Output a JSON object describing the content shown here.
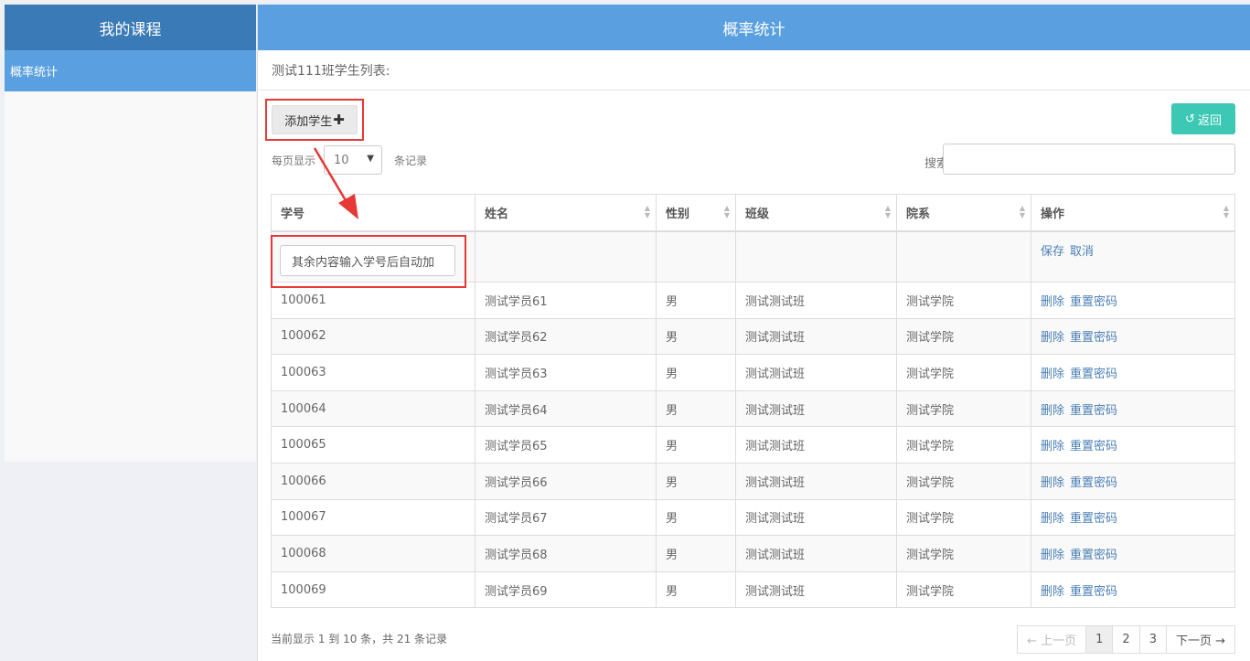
{
  "sidebar": {
    "title": "我的课程",
    "items": [
      {
        "label": "概率统计"
      }
    ]
  },
  "main": {
    "title": "概率统计",
    "subtitle": "测试111班学生列表:",
    "add_student_label": "添加学生",
    "back_label": "返回",
    "per_page_prefix": "每页显示",
    "per_page_value": "10",
    "per_page_suffix": "条记录",
    "search_label": "搜索",
    "search_value": ""
  },
  "table": {
    "columns": [
      "学号",
      "姓名",
      "性别",
      "班级",
      "院系",
      "操作"
    ],
    "edit_row": {
      "input_placeholder": "其余内容输入学号后自动加",
      "save_label": "保存",
      "cancel_label": "取消"
    },
    "action_labels": {
      "delete": "删除",
      "reset": "重置密码"
    },
    "rows": [
      {
        "id": "100061",
        "name": "测试学员61",
        "gender": "男",
        "class": "测试测试班",
        "dept": "测试学院"
      },
      {
        "id": "100062",
        "name": "测试学员62",
        "gender": "男",
        "class": "测试测试班",
        "dept": "测试学院"
      },
      {
        "id": "100063",
        "name": "测试学员63",
        "gender": "男",
        "class": "测试测试班",
        "dept": "测试学院"
      },
      {
        "id": "100064",
        "name": "测试学员64",
        "gender": "男",
        "class": "测试测试班",
        "dept": "测试学院"
      },
      {
        "id": "100065",
        "name": "测试学员65",
        "gender": "男",
        "class": "测试测试班",
        "dept": "测试学院"
      },
      {
        "id": "100066",
        "name": "测试学员66",
        "gender": "男",
        "class": "测试测试班",
        "dept": "测试学院"
      },
      {
        "id": "100067",
        "name": "测试学员67",
        "gender": "男",
        "class": "测试测试班",
        "dept": "测试学院"
      },
      {
        "id": "100068",
        "name": "测试学员68",
        "gender": "男",
        "class": "测试测试班",
        "dept": "测试学院"
      },
      {
        "id": "100069",
        "name": "测试学员69",
        "gender": "男",
        "class": "测试测试班",
        "dept": "测试学院"
      }
    ]
  },
  "footer": {
    "info": "当前显示 1 到 10 条，共 21 条记录",
    "prev_label": "← 上一页",
    "next_label": "下一页 →",
    "pages": [
      "1",
      "2",
      "3"
    ],
    "current_page": "1"
  },
  "colors": {
    "header_blue": "#5aa0e0",
    "sidebar_header": "#3a7ab6",
    "back_button": "#3cc8b4",
    "annotation_red": "#e53935",
    "link": "#4a7fb5"
  }
}
